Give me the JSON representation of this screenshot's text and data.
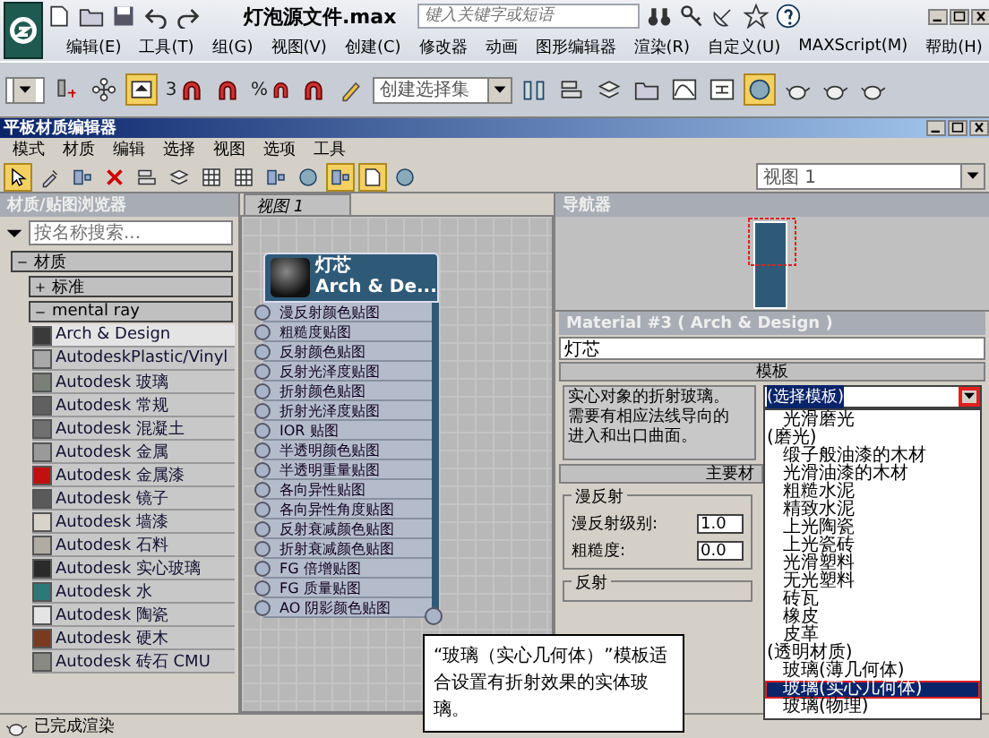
{
  "app": {
    "title": "灯泡源文件.max",
    "search": {
      "placeholder": "键入关键字或短语"
    },
    "menu": [
      "编辑(E)",
      "工具(T)",
      "组(G)",
      "视图(V)",
      "创建(C)",
      "修改器",
      "动画",
      "图形编辑器",
      "渲染(R)",
      "自定义(U)",
      "MAXScript(M)",
      "帮助(H)"
    ]
  },
  "main_toolbar": {
    "buttons": [
      {
        "active": false
      },
      {
        "active": false
      },
      {
        "active": true
      },
      {
        "label": "3",
        "active": false
      },
      {
        "active": false
      },
      {
        "label": "%",
        "active": false
      },
      {
        "active": false
      },
      {
        "active": false
      }
    ],
    "selection_set": {
      "value": "创建选择集"
    },
    "buttons_right": [
      {
        "active": false
      },
      {
        "active": false
      },
      {
        "active": false
      },
      {
        "active": false
      },
      {
        "active": false
      },
      {
        "active": false
      },
      {
        "active": true
      },
      {
        "active": false
      },
      {
        "active": false
      },
      {
        "active": false
      }
    ]
  },
  "editor": {
    "title": "平板材质编辑器",
    "menu": [
      "模式",
      "材质",
      "编辑",
      "选择",
      "视图",
      "选项",
      "工具"
    ],
    "toolbar": [
      {
        "active": true
      },
      {
        "active": false
      },
      {
        "active": false
      },
      {
        "active": false
      },
      {
        "active": false
      },
      {
        "active": false
      },
      {
        "active": false
      },
      {
        "active": false
      },
      {
        "active": false
      },
      {
        "active": false
      },
      {
        "active": true
      },
      {
        "active": true
      },
      {
        "active": false
      }
    ],
    "view_select": {
      "value": "视图 1"
    }
  },
  "browser": {
    "title": "材质/贴图浏览器",
    "search": {
      "placeholder": "按名称搜索..."
    },
    "group": {
      "label": "材质",
      "expanded": true,
      "children": [
        {
          "label": "标准",
          "expanded": false
        },
        {
          "label": "mental ray",
          "expanded": true
        }
      ]
    },
    "items": [
      {
        "label": "Arch & Design",
        "selected": true,
        "color": "#3a3a3a"
      },
      {
        "label": "AutodeskPlastic/Vinyl",
        "selected": false,
        "color": "#a8a8a8"
      },
      {
        "label": "Autodesk 玻璃",
        "selected": false,
        "color": "#7a8078"
      },
      {
        "label": "Autodesk 常规",
        "selected": false,
        "color": "#606060"
      },
      {
        "label": "Autodesk 混凝土",
        "selected": false,
        "color": "#707070"
      },
      {
        "label": "Autodesk 金属",
        "selected": false,
        "color": "#9a9a9a"
      },
      {
        "label": "Autodesk 金属漆",
        "selected": false,
        "color": "#c01010"
      },
      {
        "label": "Autodesk 镜子",
        "selected": false,
        "color": "#5a5a5a"
      },
      {
        "label": "Autodesk 墙漆",
        "selected": false,
        "color": "#d8d4cc"
      },
      {
        "label": "Autodesk 石料",
        "selected": false,
        "color": "#b0aca4"
      },
      {
        "label": "Autodesk 实心玻璃",
        "selected": false,
        "color": "#2a2a2a"
      },
      {
        "label": "Autodesk 水",
        "selected": false,
        "color": "#2a7a78"
      },
      {
        "label": "Autodesk 陶瓷",
        "selected": false,
        "color": "#e4e4e4"
      },
      {
        "label": "Autodesk 硬木",
        "selected": false,
        "color": "#7a3a20"
      },
      {
        "label": "Autodesk 砖石 CMU",
        "selected": false,
        "color": "#8a8a84"
      }
    ]
  },
  "view": {
    "tab": "视图 1",
    "node": {
      "title": "灯芯",
      "subtitle": "Arch & De...",
      "slots": [
        "漫反射颜色贴图",
        "粗糙度贴图",
        "反射颜色贴图",
        "反射光泽度贴图",
        "折射颜色贴图",
        "折射光泽度贴图",
        "IOR 贴图",
        "半透明颜色贴图",
        "半透明重量贴图",
        "各向异性贴图",
        "各向异性角度贴图",
        "反射衰减颜色贴图",
        "折射衰减颜色贴图",
        "FG 倍增贴图",
        "FG 质量贴图",
        "AO 阴影颜色贴图"
      ]
    }
  },
  "navigator": {
    "title": "导航器"
  },
  "material": {
    "title": "Material #3 ( Arch & Design )",
    "name": "灯芯",
    "template": {
      "title": "模板",
      "description": "实心对象的折射玻璃。需要有相应法线导向的进入和出口曲面。",
      "select": {
        "value": "(选择模板)",
        "open": true,
        "arrow_highlighted": true
      },
      "options": [
        {
          "label": "光滑磨光",
          "kind": "item",
          "selected": false
        },
        {
          "label": "(磨光)",
          "kind": "category",
          "selected": false
        },
        {
          "label": "缎子般油漆的木材",
          "kind": "item",
          "selected": false
        },
        {
          "label": "光滑油漆的木材",
          "kind": "item",
          "selected": false
        },
        {
          "label": "粗糙水泥",
          "kind": "item",
          "selected": false
        },
        {
          "label": "精致水泥",
          "kind": "item",
          "selected": false
        },
        {
          "label": "上光陶瓷",
          "kind": "item",
          "selected": false
        },
        {
          "label": "上光瓷砖",
          "kind": "item",
          "selected": false
        },
        {
          "label": "光滑塑料",
          "kind": "item",
          "selected": false
        },
        {
          "label": "无光塑料",
          "kind": "item",
          "selected": false
        },
        {
          "label": "砖瓦",
          "kind": "item",
          "selected": false
        },
        {
          "label": "橡皮",
          "kind": "item",
          "selected": false
        },
        {
          "label": "皮革",
          "kind": "item",
          "selected": false
        },
        {
          "label": "(透明材质)",
          "kind": "category",
          "selected": false
        },
        {
          "label": "玻璃(薄几何体)",
          "kind": "item",
          "selected": false
        },
        {
          "label": "玻璃(实心几何体)",
          "kind": "item",
          "selected": true
        },
        {
          "label": "玻璃(物理)",
          "kind": "item",
          "selected": false
        }
      ]
    },
    "main": {
      "title": "主要材",
      "diffuse": {
        "title": "漫反射",
        "fields": [
          {
            "label": "漫反射级别:",
            "value": "1.0"
          },
          {
            "label": "粗糙度:",
            "value": "0.0"
          }
        ]
      },
      "reflection": {
        "title": "反射"
      }
    }
  },
  "callout": {
    "text": "“玻璃（实心几何体）”模板适合设置有折射效果的实体玻璃。"
  },
  "status": {
    "text": "已完成渲染"
  }
}
